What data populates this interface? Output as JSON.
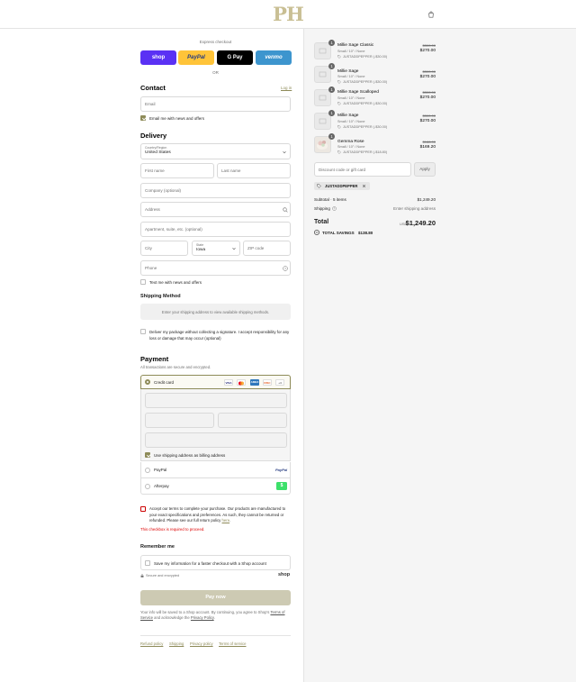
{
  "header": {
    "logo_text": "PH",
    "bag_icon": "shopping-bag-icon"
  },
  "express": {
    "title": "Express checkout",
    "or": "OR",
    "buttons": [
      {
        "label": "shop",
        "color": "#5a31f4"
      },
      {
        "label": "PayPal",
        "color": "#ffc439"
      },
      {
        "label": "G Pay",
        "color": "#000000"
      },
      {
        "label": "venmo",
        "color": "#3d95ce"
      }
    ]
  },
  "contact": {
    "heading": "Contact",
    "login": "Log in",
    "email_placeholder": "Email",
    "news_label": "Email me with news and offers"
  },
  "delivery": {
    "heading": "Delivery",
    "country_label": "Country/Region",
    "country_value": "United States",
    "first_name": "First name",
    "last_name": "Last name",
    "company": "Company (optional)",
    "address": "Address",
    "apartment": "Apartment, suite, etc. (optional)",
    "city": "City",
    "state_label": "State",
    "state_value": "Iowa",
    "zip": "ZIP code",
    "phone": "Phone",
    "text_label": "Text me with news and offers"
  },
  "shipping_method": {
    "heading": "Shipping Method",
    "notice": "Enter your shipping address to view available shipping methods.",
    "signature_text": "Deliver my package without collecting a signature. I accept responsibility for any loss or damage that may occur (optional)"
  },
  "payment": {
    "heading": "Payment",
    "subtext": "All transactions are secure and encrypted.",
    "credit_card": "Credit card",
    "card_brands": [
      "VISA",
      "MC",
      "AMEX",
      "DISC",
      "+4"
    ],
    "billing_label": "Use shipping address as billing address",
    "paypal": "PayPal",
    "paypal_logo": "PayPal",
    "afterpay": "Afterpay",
    "afterpay_logo": "$"
  },
  "terms": {
    "text": "Accept our terms to complete your purchase. Our products are manufactured to your exact specifications and preferences. As such, they cannot be returned or refunded. Please see our full return policy",
    "link": "here",
    "error": "This checkbox is required to proceed."
  },
  "remember": {
    "heading": "Remember me",
    "save_label": "Save my information for a faster checkout with a Shop account",
    "secure": "Secure and encrypted",
    "shop_logo": "shop"
  },
  "pay_button": "Pay now",
  "legal": {
    "prefix": "Your info will be saved to a Shop account. By continuing, you agree to Shop's",
    "tos": "Terms of Service",
    "mid": "and acknowledge the",
    "privacy": "Privacy Policy"
  },
  "footer_links": [
    "Refund policy",
    "Shipping",
    "Privacy policy",
    "Terms of service"
  ],
  "cart": {
    "items": [
      {
        "qty": "1",
        "name": "Millie Sage Classic",
        "variant": "Small / 10\" / None",
        "discount": "JUSTADDPEPPER (-$30.00)",
        "old_price": "$300.00",
        "price": "$270.00"
      },
      {
        "qty": "1",
        "name": "Millie Sage",
        "variant": "Small / 10\" / None",
        "discount": "JUSTADDPEPPER (-$30.00)",
        "old_price": "$300.00",
        "price": "$270.00"
      },
      {
        "qty": "1",
        "name": "Millie Sage Scalloped",
        "variant": "Small / 10\" / None",
        "discount": "JUSTADDPEPPER (-$30.00)",
        "old_price": "$300.00",
        "price": "$270.00"
      },
      {
        "qty": "1",
        "name": "Millie Sage",
        "variant": "Small / 10\" / None",
        "discount": "JUSTADDPEPPER (-$30.00)",
        "old_price": "$300.00",
        "price": "$270.00"
      },
      {
        "qty": "1",
        "name": "Gemma Rose",
        "variant": "Small / 10\" / None",
        "discount": "JUSTADDPEPPER (-$18.80)",
        "old_price": "$188.00",
        "price": "$169.20"
      }
    ],
    "discount_placeholder": "Discount code or gift card",
    "apply": "Apply",
    "applied_code": "JUSTADDPEPPER",
    "subtotal_label": "Subtotal · 5 items",
    "subtotal_value": "$1,249.20",
    "shipping_label": "Shipping",
    "shipping_value": "Enter shipping address",
    "total_label": "Total",
    "currency": "USD",
    "total_value": "$1,249.20",
    "savings_label": "TOTAL SAVINGS",
    "savings_value": "$138.80"
  }
}
